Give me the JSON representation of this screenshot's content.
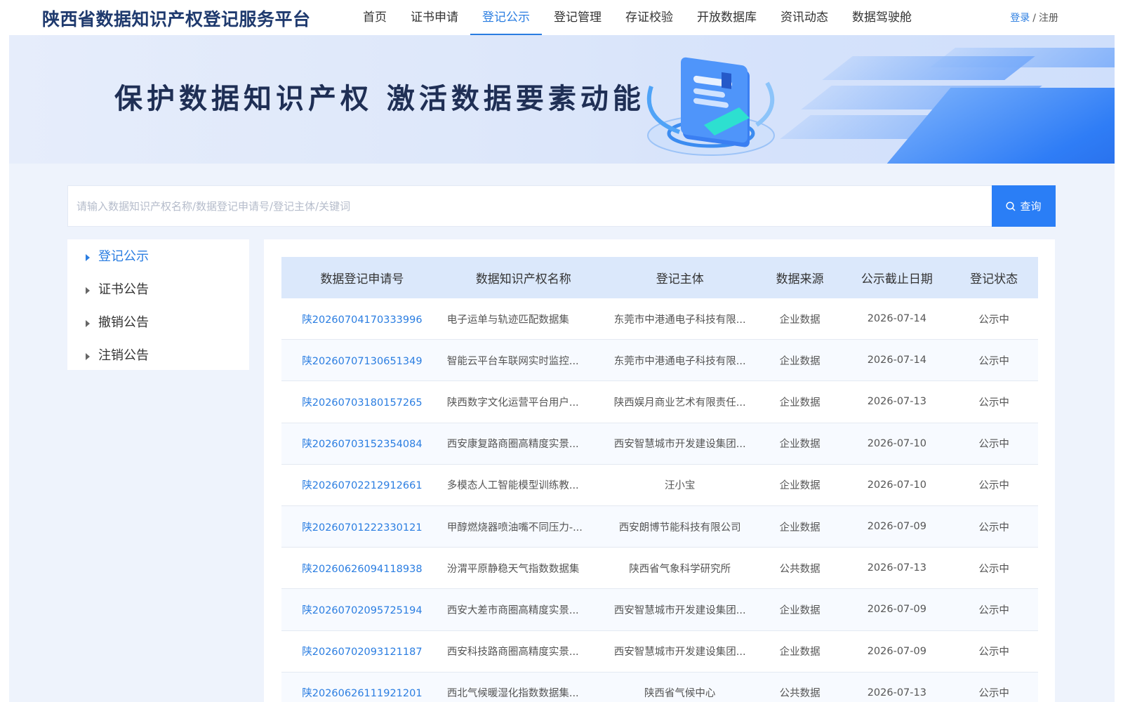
{
  "header": {
    "logo": "陕西省数据知识产权登记服务平台",
    "nav": [
      "首页",
      "证书申请",
      "登记公示",
      "登记管理",
      "存证校验",
      "开放数据库",
      "资讯动态",
      "数据驾驶舱"
    ],
    "active_nav": "登记公示",
    "login": "登录",
    "separator": "/",
    "register": "注册"
  },
  "banner": {
    "slogan": "保护数据知识产权 激活数据要素动能"
  },
  "search": {
    "placeholder": "请输入数据知识产权名称/数据登记申请号/登记主体/关键词",
    "value": "",
    "button": "查询",
    "icon": "search-icon"
  },
  "sidebar": {
    "items": [
      {
        "label": "登记公示",
        "active": true
      },
      {
        "label": "证书公告",
        "active": false
      },
      {
        "label": "撤销公告",
        "active": false
      },
      {
        "label": "注销公告",
        "active": false
      }
    ]
  },
  "table": {
    "headers": [
      "数据登记申请号",
      "数据知识产权名称",
      "登记主体",
      "数据来源",
      "公示截止日期",
      "登记状态"
    ],
    "rows": [
      {
        "id": "陕20260704170333996",
        "name": "电子运单与轨迹匹配数据集",
        "entity": "东莞市中港通电子科技有限...",
        "source": "企业数据",
        "deadline": "2026-07-14",
        "status": "公示中"
      },
      {
        "id": "陕20260707130651349",
        "name": "智能云平台车联网实时监控...",
        "entity": "东莞市中港通电子科技有限...",
        "source": "企业数据",
        "deadline": "2026-07-14",
        "status": "公示中"
      },
      {
        "id": "陕20260703180157265",
        "name": "陕西数字文化运营平台用户...",
        "entity": "陕西娱月商业艺术有限责任...",
        "source": "企业数据",
        "deadline": "2026-07-13",
        "status": "公示中"
      },
      {
        "id": "陕20260703152354084",
        "name": "西安康复路商圈高精度实景...",
        "entity": "西安智慧城市开发建设集团...",
        "source": "企业数据",
        "deadline": "2026-07-10",
        "status": "公示中"
      },
      {
        "id": "陕20260702212912661",
        "name": "多模态人工智能模型训练教...",
        "entity": "汪小宝",
        "source": "企业数据",
        "deadline": "2026-07-10",
        "status": "公示中"
      },
      {
        "id": "陕20260701222330121",
        "name": "甲醇燃烧器喷油嘴不同压力-...",
        "entity": "西安朗博节能科技有限公司",
        "source": "企业数据",
        "deadline": "2026-07-09",
        "status": "公示中"
      },
      {
        "id": "陕20260626094118938",
        "name": "汾渭平原静稳天气指数数据集",
        "entity": "陕西省气象科学研究所",
        "source": "公共数据",
        "deadline": "2026-07-13",
        "status": "公示中"
      },
      {
        "id": "陕20260702095725194",
        "name": "西安大差市商圈高精度实景...",
        "entity": "西安智慧城市开发建设集团...",
        "source": "企业数据",
        "deadline": "2026-07-09",
        "status": "公示中"
      },
      {
        "id": "陕20260702093121187",
        "name": "西安科技路商圈高精度实景...",
        "entity": "西安智慧城市开发建设集团...",
        "source": "企业数据",
        "deadline": "2026-07-09",
        "status": "公示中"
      },
      {
        "id": "陕20260626111921201",
        "name": "西北气候暖湿化指数数据集...",
        "entity": "陕西省气候中心",
        "source": "公共数据",
        "deadline": "2026-07-13",
        "status": "公示中"
      }
    ]
  },
  "colors": {
    "accent": "#2a7de1",
    "button": "#2a7ef6",
    "table_header_bg": "#dbe8fb",
    "page_bg": "#eef3fc"
  }
}
